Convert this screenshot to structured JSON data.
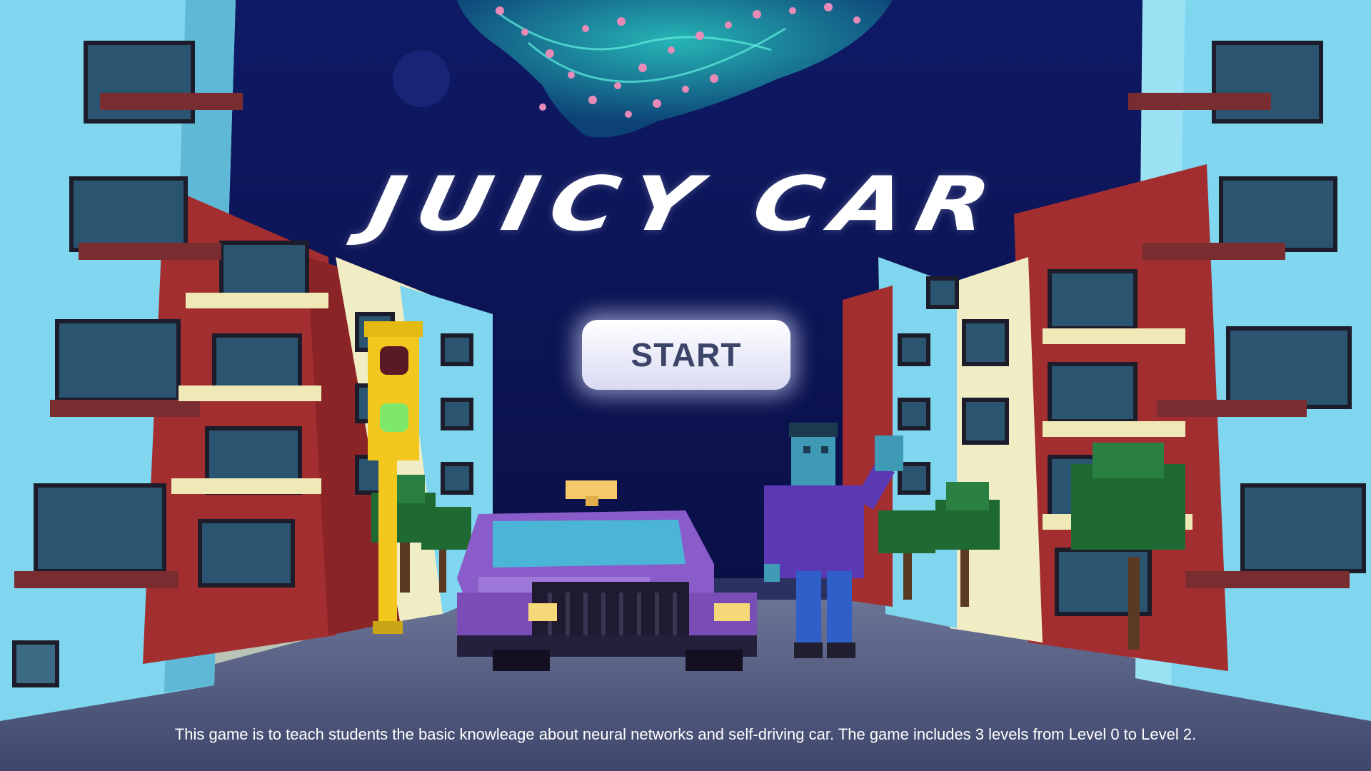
{
  "game": {
    "title": "JUICY CAR",
    "start_label": "START",
    "description": "This game is to teach students the basic knowleage about neural networks and self-driving car. The game includes 3 levels from Level 0 to Level 2."
  },
  "colors": {
    "sky": "#0d124d",
    "road": "#4a5478",
    "building_cyan": "#7fd6ee",
    "building_red": "#a32e30",
    "taxi": "#8a5cc9",
    "taxi_sign": "#f5c96a",
    "traffic_light": "#f2c81f",
    "person_shirt": "#5b38b4",
    "person_skin": "#3f9bb5",
    "start_text": "#3c4468"
  }
}
